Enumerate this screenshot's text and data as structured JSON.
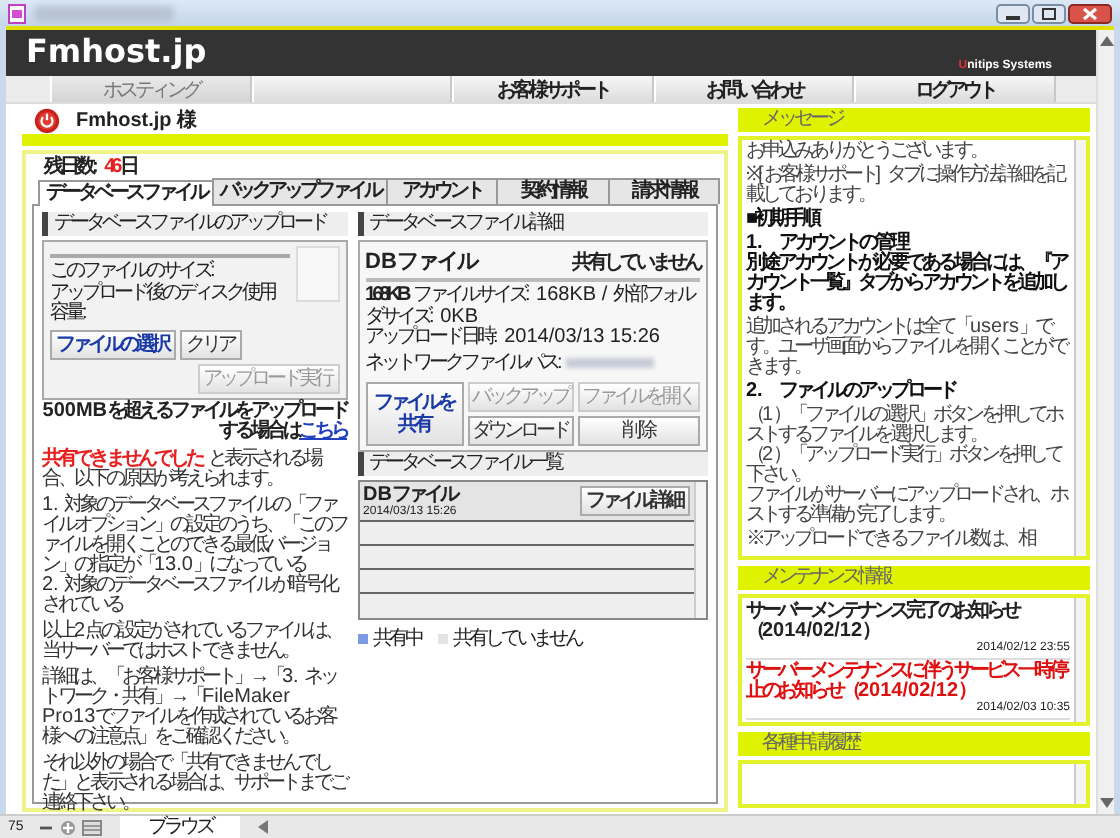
{
  "header": {
    "logo": "Fmhost.jp",
    "company": {
      "initial": "U",
      "rest": "nitips Systems"
    }
  },
  "nav": [
    {
      "label": "ホスティング",
      "selected": true
    },
    {
      "kind": "spacer"
    },
    {
      "label": "お客様サポート",
      "selected": false
    },
    {
      "label": "お問い合わせ",
      "selected": false
    },
    {
      "label": "ログアウト",
      "selected": false
    }
  ],
  "user": {
    "name": "Fmhost.jp 様"
  },
  "remaining": {
    "label": "残日数:",
    "value": "46",
    "unit": "日"
  },
  "tabs": [
    {
      "label": "データベースファイル",
      "selected": true
    },
    {
      "label": "バックアップファイル",
      "selected": false
    },
    {
      "label": "アカウント",
      "selected": false
    },
    {
      "label": "契約情報",
      "selected": false
    },
    {
      "label": "請求情報",
      "selected": false
    }
  ],
  "upload": {
    "heading": "データベースファイルのアップロード",
    "size_label": "このファイルのサイズ:",
    "usage_label": "アップロード後のディスク使用容量:",
    "buttons": [
      {
        "label": "ファイルの選択",
        "kind": "primary",
        "disabled": false
      },
      {
        "label": "クリア",
        "kind": "normal",
        "disabled": false
      },
      {
        "label": "アップロード実行",
        "kind": "normal",
        "disabled": true
      }
    ],
    "note": {
      "text": "500MBを超えるファイルをアップロードする場合は",
      "link": "こちら"
    }
  },
  "notes": [
    {
      "lines": [
        {
          "highlight": "共有できませんでした",
          "text": " と表示される場合、以下の原因が考えられます。"
        }
      ]
    },
    {
      "lines": [
        {
          "text": "1. 対象のデータベースファイルの「ファイルオプション」の設定のうち、「このファイルを開くことのできる最低バージョン」の指定が「13.0」になっている"
        },
        {
          "text": "2. 対象のデータベースファイルが暗号化されている"
        }
      ]
    },
    {
      "lines": [
        {
          "text": "以上2点の設定がされているファイルは、当サーバーではホストできません。"
        }
      ]
    },
    {
      "lines": [
        {
          "text": "詳細は、「お客様サポート」→「3. ネットワーク・共有」→「FileMaker Pro13でファイルを作成されているお客様への注意点」をご確認ください。"
        }
      ]
    },
    {
      "lines": [
        {
          "text": "それ以外の場合で「共有できませんでした」と表示される場合は、サポートまでご連絡下さい。"
        }
      ]
    }
  ],
  "detail": {
    "heading": "データベースファイル詳細",
    "name": "DBファイル",
    "status": "共有していません",
    "size": "168KB",
    "size_text": " ファイルサイズ: 168KB / 外部フォルダサイズ: 0KB",
    "uploaded": "アップロード日時: 2014/03/13 15:26",
    "path_label": "ネットワークファイルパス:",
    "share_button": {
      "label": "ファイルを共有",
      "disabled": false
    },
    "buttons": [
      {
        "label": "バックアップ",
        "disabled": true
      },
      {
        "label": "ファイルを開く",
        "disabled": true
      },
      {
        "label": "ダウンロード",
        "disabled": false
      },
      {
        "label": "削除",
        "disabled": false
      }
    ]
  },
  "file_list": {
    "heading": "データベースファイル一覧",
    "rows": [
      {
        "name": "DBファイル",
        "date": "2014/03/13 15:26",
        "button": "ファイル詳細",
        "shared": false
      }
    ],
    "legend": [
      {
        "label": "共有中",
        "color": "#7b9be6"
      },
      {
        "label": "共有していません",
        "color": "#e4e4e4"
      }
    ]
  },
  "messages": {
    "heading": "メッセージ",
    "blocks": [
      {
        "bold": false,
        "lines": [
          "お申込みありがとうございます。"
        ]
      },
      {
        "bold": false,
        "lines": [
          "※[お客様サポート] タブに操作方法詳細を記載しております。"
        ]
      },
      {
        "bold": true,
        "lines": [
          "■初期手順"
        ]
      },
      {
        "bold": true,
        "lines": [
          "1.　アカウントの管理",
          "別途アカウントが必要である場合には、『アカウント一覧』タブからアカウントを追加します。"
        ]
      },
      {
        "bold": false,
        "lines": [
          "追加されるアカウントは全て「users」です。ユーザ画面からファイルを開くことができます。"
        ]
      },
      {
        "bold": true,
        "lines": [
          "2.　ファイルのアップロード"
        ]
      },
      {
        "bold": false,
        "lines": [
          "（1）「ファイルの選択」ボタンを押してホストするファイルを選択します。",
          "（2）「アップロード実行」ボタンを押して下さい。",
          "ファイルがサーバーにアップロードされ、ホストする準備が完了します。"
        ]
      },
      {
        "bold": false,
        "lines": [
          "※アップロードできるファイル数は、相"
        ]
      }
    ]
  },
  "maintenance": {
    "heading": "メンテナンス情報",
    "items": [
      {
        "title": "サーバーメンテナンス完了のお知らせ（2014/02/12）",
        "date": "2014/02/12 23:55",
        "important": false
      },
      {
        "title": "サーバーメンテナンスに伴うサービス一時停止のお知らせ（2014/02/12）",
        "date": "2014/02/03 10:35",
        "important": true
      }
    ]
  },
  "history": {
    "heading": "各種申請履歴"
  },
  "status_bar": {
    "zoom": "75",
    "mode": "ブラウズ"
  }
}
